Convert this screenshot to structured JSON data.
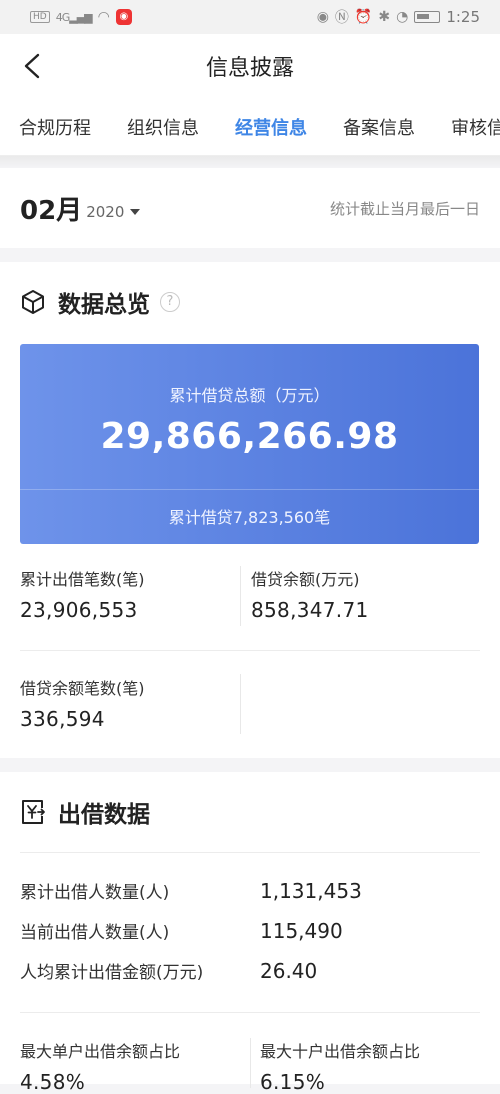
{
  "status_bar": {
    "left_badge": "HD",
    "network": "4G",
    "time": "1:25"
  },
  "nav": {
    "title": "信息披露"
  },
  "tabs": [
    {
      "label": "合规历程"
    },
    {
      "label": "组织信息"
    },
    {
      "label": "经营信息",
      "active": true
    },
    {
      "label": "备案信息"
    },
    {
      "label": "审核信"
    }
  ],
  "month_selector": {
    "month": "02月",
    "year": "2020",
    "note": "统计截止当月最后一日"
  },
  "overview": {
    "title": "数据总览",
    "help": "?",
    "card": {
      "label": "累计借贷总额（万元）",
      "value": "29,866,266.98",
      "sub": "累计借贷7,823,560笔"
    },
    "stats": [
      {
        "label": "累计出借笔数(笔)",
        "value": "23,906,553"
      },
      {
        "label": "借贷余额(万元)",
        "value": "858,347.71"
      },
      {
        "label": "借贷余额笔数(笔)",
        "value": "336,594"
      }
    ]
  },
  "lending": {
    "title": "出借数据",
    "rows": [
      {
        "label": "累计出借人数量(人)",
        "value": "1,131,453"
      },
      {
        "label": "当前出借人数量(人)",
        "value": "115,490"
      },
      {
        "label": "人均累计出借金额(万元)",
        "value": "26.40"
      }
    ],
    "ratios": [
      {
        "label": "最大单户出借余额占比",
        "value": "4.58%"
      },
      {
        "label": "最大十户出借余额占比",
        "value": "6.15%"
      }
    ]
  },
  "colors": {
    "accent": "#3f86e6",
    "card_start": "#6e93ea",
    "card_end": "#4b73d9"
  }
}
